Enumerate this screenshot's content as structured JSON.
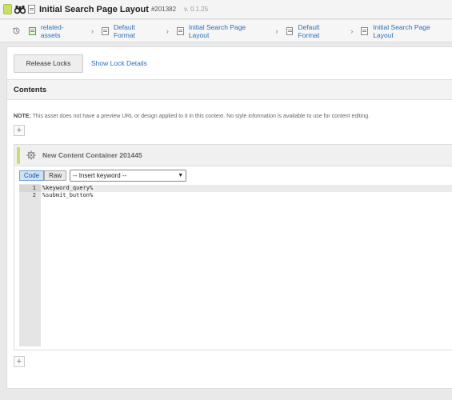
{
  "header": {
    "title": "Initial Search Page Layout",
    "asset_id": "#201382",
    "version": "v. 0.1.25"
  },
  "breadcrumb": [
    {
      "label": "related-assets"
    },
    {
      "label": "Default Format"
    },
    {
      "label": "Initial Search Page Layout"
    },
    {
      "label": "Default Format"
    },
    {
      "label": "Initial Search Page Layout"
    }
  ],
  "locks": {
    "release_label": "Release Locks",
    "details_label": "Show Lock Details"
  },
  "contents": {
    "heading": "Contents",
    "note_prefix": "NOTE:",
    "note_text": " This asset does not have a preview URL or design applied to it in this context. No style information is available to use for content editing."
  },
  "container": {
    "title": "New Content Container 201445",
    "tab_code": "Code",
    "tab_raw": "Raw",
    "keyword_select": "-- Insert keyword --",
    "line_numbers": [
      "1",
      "2"
    ],
    "code_lines": [
      "%keyword_query%",
      "%submit_button%"
    ]
  },
  "colors": {
    "link": "#2a6ebb",
    "status_accent": "#c8e06a",
    "active_tab": "#cde2f8"
  }
}
